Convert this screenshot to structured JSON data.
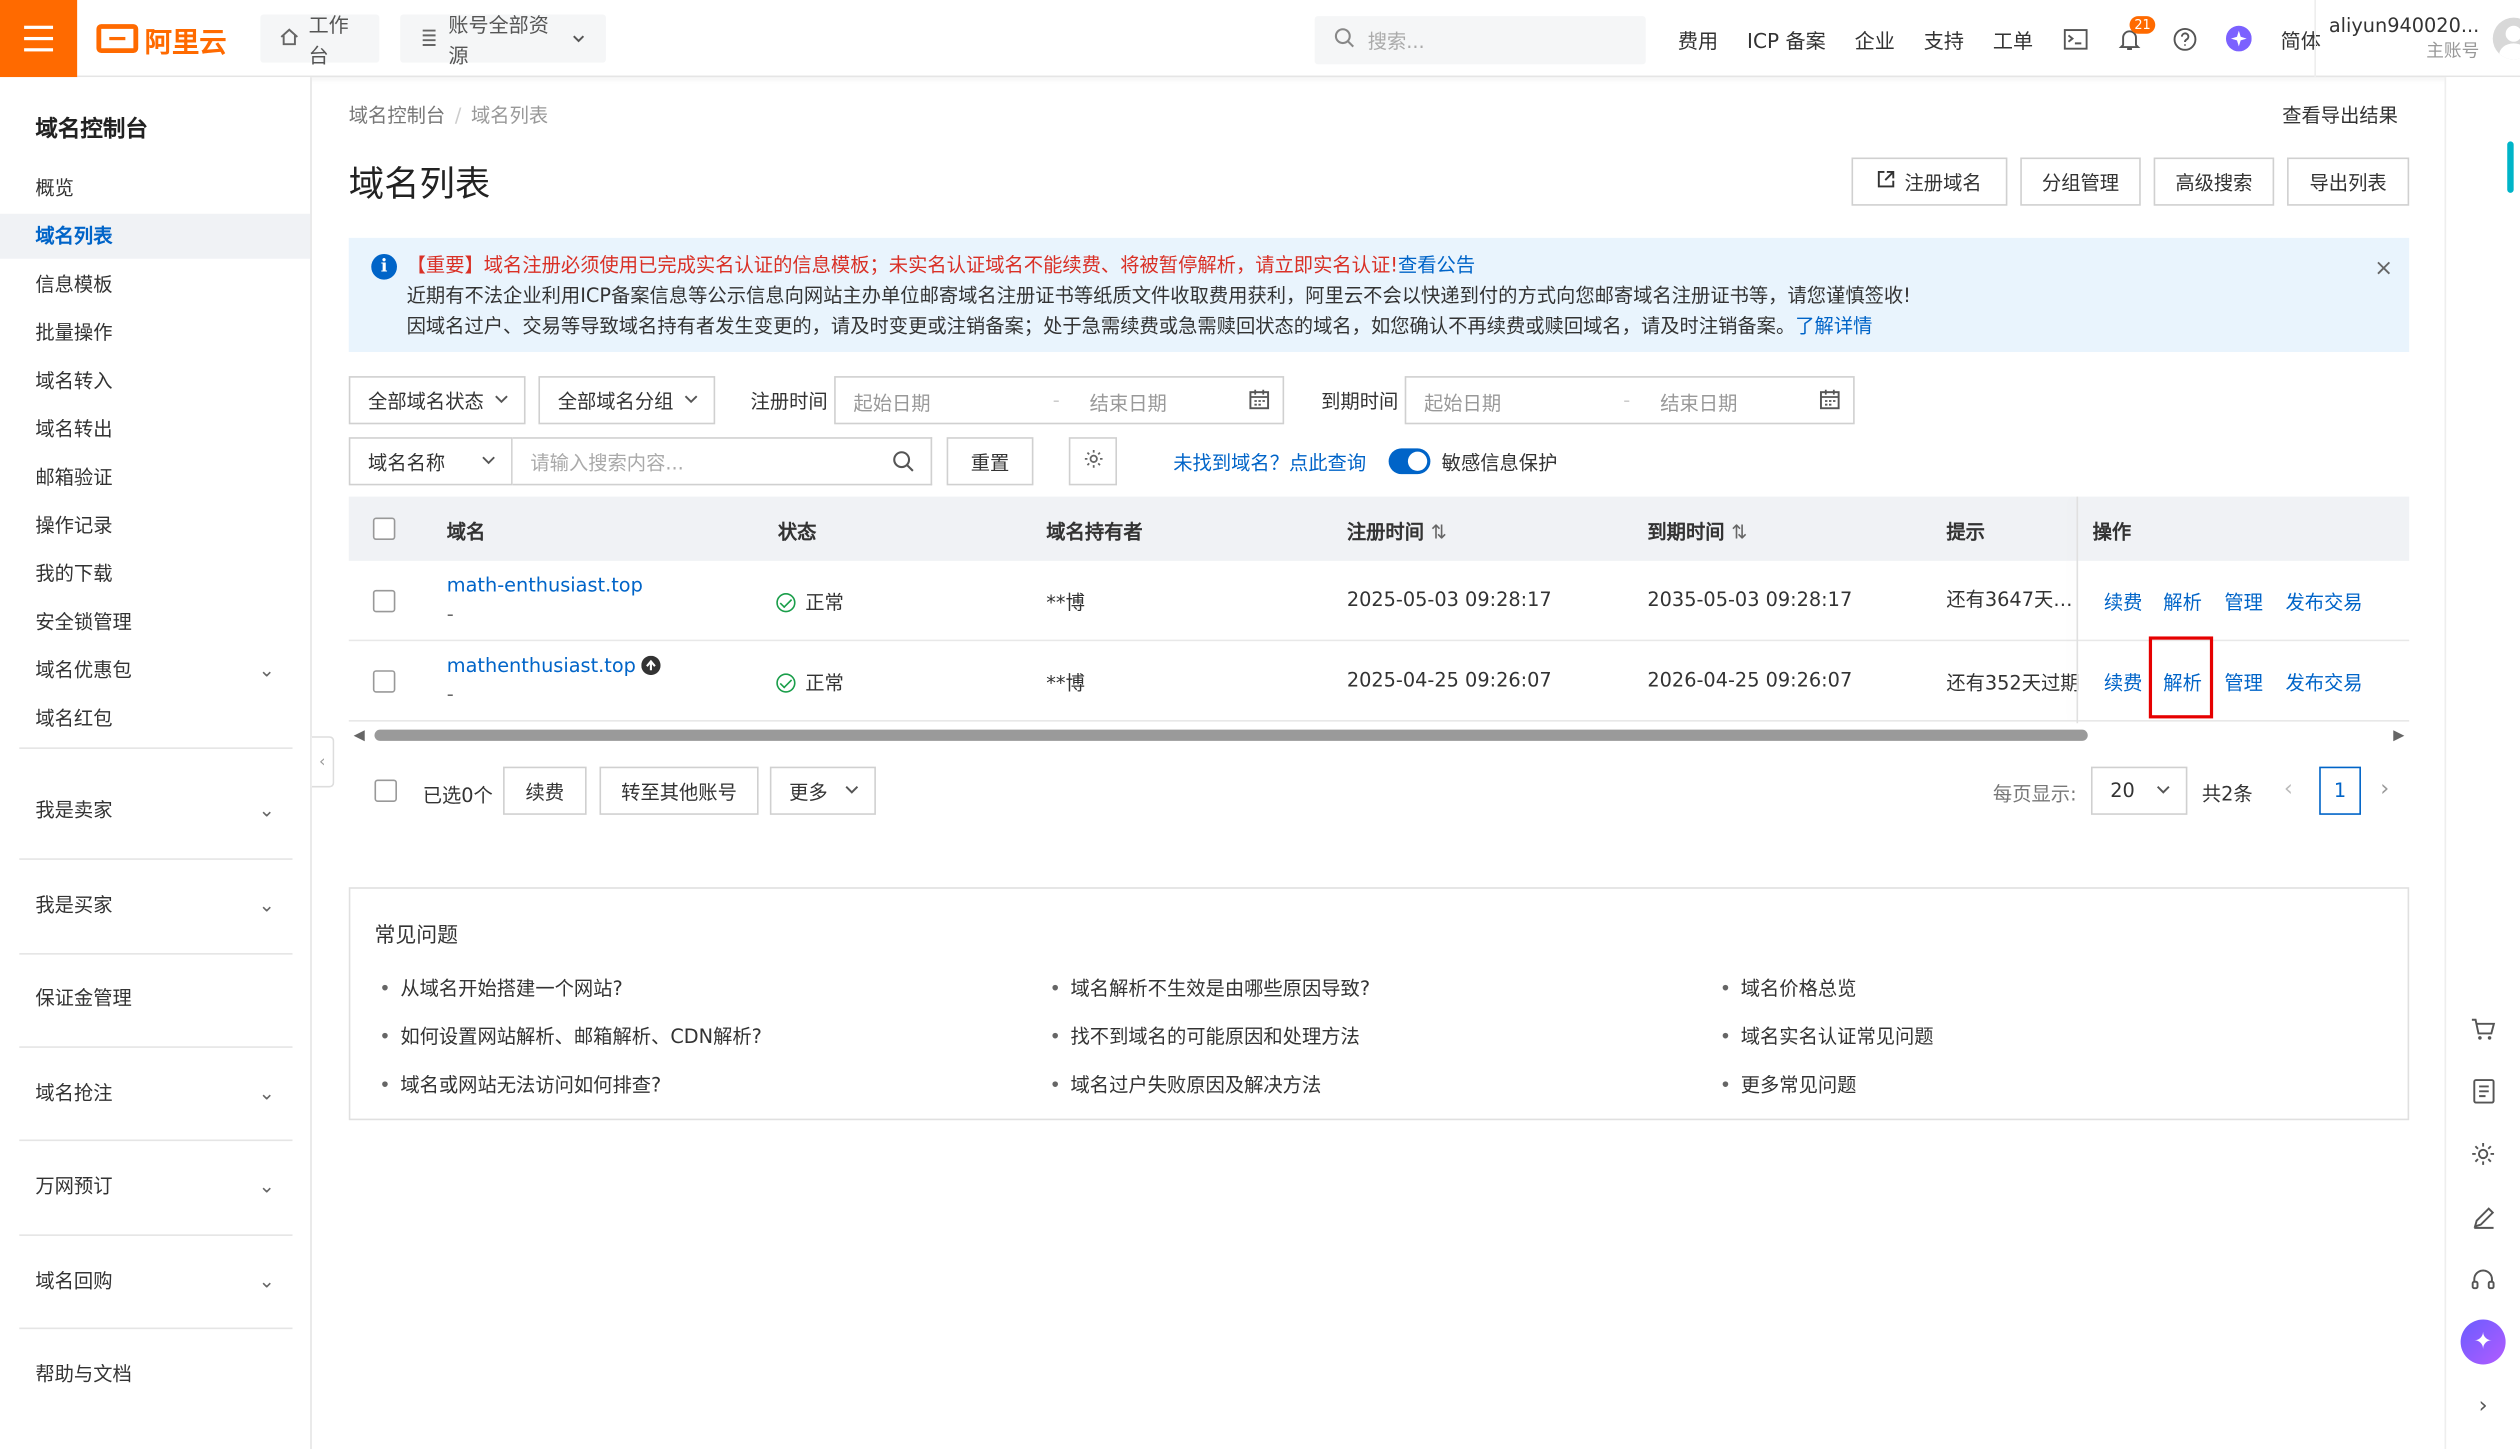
{
  "header": {
    "logo_text": "阿里云",
    "workbench": "工作台",
    "resources": "账号全部资源",
    "search_placeholder": "搜索...",
    "nav": [
      "费用",
      "ICP 备案",
      "企业",
      "支持",
      "工单"
    ],
    "notification_count": "21",
    "language": "简体",
    "account_name": "aliyun940020...",
    "account_type": "主账号"
  },
  "sidebar": {
    "title": "域名控制台",
    "items": [
      "概览",
      "域名列表",
      "信息模板",
      "批量操作",
      "域名转入",
      "域名转出",
      "邮箱验证",
      "操作记录",
      "我的下载",
      "安全锁管理",
      "域名优惠包",
      "域名红包"
    ],
    "groups": [
      "我是卖家",
      "我是买家",
      "保证金管理",
      "域名抢注",
      "万网预订",
      "域名回购",
      "帮助与文档"
    ]
  },
  "breadcrumb": {
    "root": "域名控制台",
    "current": "域名列表"
  },
  "export_results": "查看导出结果",
  "page_title": "域名列表",
  "header_buttons": {
    "register": "注册域名",
    "group": "分组管理",
    "advanced": "高级搜索",
    "export": "导出列表"
  },
  "notice": {
    "line1_red": "【重要】域名注册必须使用已完成实名认证的信息模板；未实名认证域名不能续费、将被暂停解析，请立即实名认证!",
    "line1_link": "查看公告",
    "line2": "近期有不法企业利用ICP备案信息等公示信息向网站主办单位邮寄域名注册证书等纸质文件收取费用获利，阿里云不会以快递到付的方式向您邮寄域名注册证书等，请您谨慎签收!",
    "line3": "因域名过户、交易等导致域名持有者发生变更的，请及时变更或注销备案；处于急需续费或急需赎回状态的域名，如您确认不再续费或赎回域名，请及时注销备案。",
    "line3_link": "了解详情"
  },
  "filters": {
    "status": "全部域名状态",
    "group": "全部域名分组",
    "reg_time_label": "注册时间",
    "exp_time_label": "到期时间",
    "start_date": "起始日期",
    "end_date": "结束日期",
    "name_type": "域名名称",
    "search_placeholder": "请输入搜索内容...",
    "reset": "重置",
    "not_found": "未找到域名？点此查询",
    "privacy": "敏感信息保护"
  },
  "table": {
    "headers": {
      "domain": "域名",
      "status": "状态",
      "owner": "域名持有者",
      "reg": "注册时间",
      "exp": "到期时间",
      "hint": "提示",
      "ops": "操作"
    },
    "rows": [
      {
        "domain": "math-enthusiast.top",
        "sub": "-",
        "status": "正常",
        "owner": "**博",
        "reg": "2025-05-03 09:28:17",
        "exp": "2035-05-03 09:28:17",
        "hint": "还有3647天…"
      },
      {
        "domain": "mathenthusiast.top",
        "sub": "-",
        "status": "正常",
        "owner": "**博",
        "reg": "2025-04-25 09:26:07",
        "exp": "2026-04-25 09:26:07",
        "hint": "还有352天过期"
      }
    ],
    "actions": {
      "renew": "续费",
      "dns": "解析",
      "manage": "管理",
      "trade": "发布交易"
    }
  },
  "footer_bar": {
    "selected": "已选0个",
    "renew": "续费",
    "transfer": "转至其他账号",
    "more": "更多",
    "per_page_label": "每页显示:",
    "per_page": "20",
    "total": "共2条",
    "page": "1"
  },
  "faq": {
    "title": "常见问题",
    "col1": [
      "从域名开始搭建一个网站?",
      "如何设置网站解析、邮箱解析、CDN解析?",
      "域名或网站无法访问如何排查?"
    ],
    "col2": [
      "域名解析不生效是由哪些原因导致?",
      "找不到域名的可能原因和处理方法",
      "域名过户失败原因及解决方法"
    ],
    "col3": [
      "域名价格总览",
      "域名实名认证常见问题",
      "更多常见问题"
    ]
  },
  "colors": {
    "brand": "#ff6a00",
    "link": "#0064c8",
    "danger": "#d93026",
    "success": "#1a9e4a",
    "highlight": "#e60000"
  }
}
